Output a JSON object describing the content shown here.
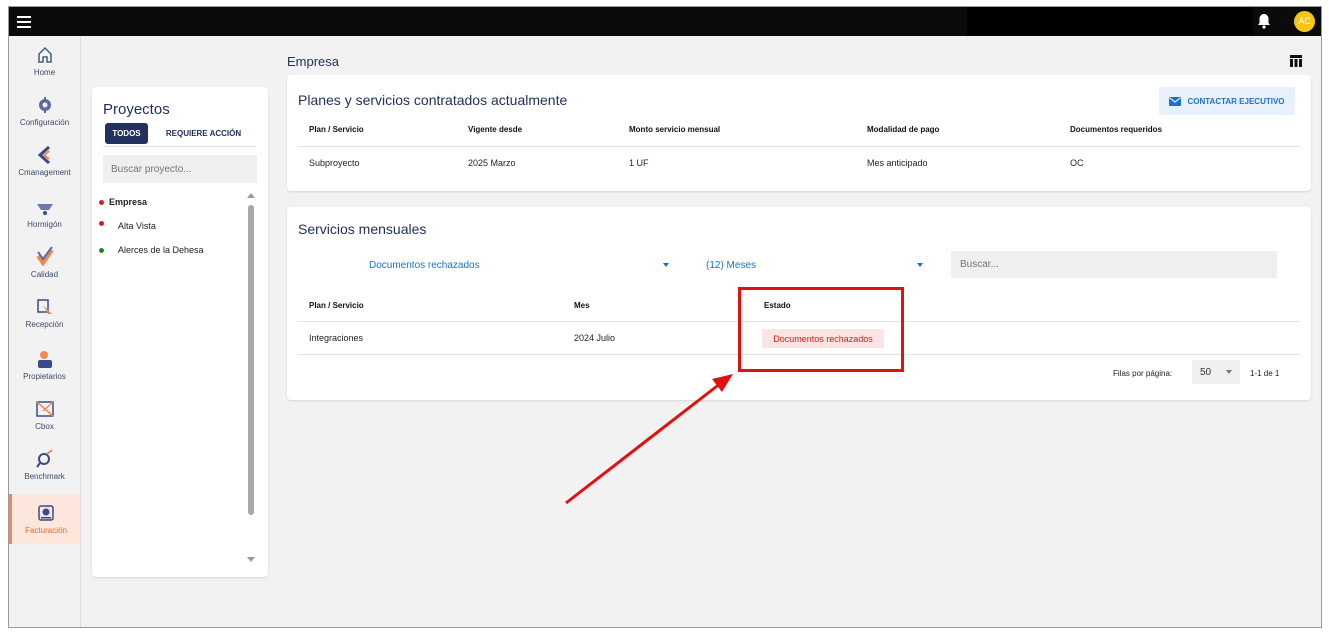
{
  "topbar": {
    "avatar_initials": "AC"
  },
  "nav": {
    "items": [
      {
        "label": "Home",
        "icon": "home-icon"
      },
      {
        "label": "Configuración",
        "icon": "gear-icon"
      },
      {
        "label": "Cmanagement",
        "icon": "cmanagement-icon"
      },
      {
        "label": "Hormigón",
        "icon": "wheelbarrow-icon"
      },
      {
        "label": "Calidad",
        "icon": "quality-check-icon"
      },
      {
        "label": "Recepción",
        "icon": "reception-icon"
      },
      {
        "label": "Propietarios",
        "icon": "owners-icon"
      },
      {
        "label": "Cbox",
        "icon": "cbox-icon"
      },
      {
        "label": "Benchmark",
        "icon": "benchmark-icon"
      },
      {
        "label": "Facturación",
        "icon": "billing-icon",
        "active": true
      }
    ]
  },
  "projects": {
    "title": "Proyectos",
    "tab_all": "TODOS",
    "tab_action": "REQUIERE ACCIÓN",
    "search_placeholder": "Buscar proyecto...",
    "items": [
      {
        "name": "Empresa",
        "status_color": "#e01b1b",
        "selected": true
      },
      {
        "name": "Alta Vista",
        "status_color": "#e01b1b"
      },
      {
        "name": "Alerces de la Dehesa",
        "status_color": "#1c8a1c"
      }
    ]
  },
  "page": {
    "title": "Empresa"
  },
  "plans": {
    "title": "Planes y servicios contratados actualmente",
    "contact_button": "CONTACTAR EJECUTIVO",
    "columns": [
      "Plan / Servicio",
      "Vigente desde",
      "Monto servicio mensual",
      "Modalidad de pago",
      "Documentos requeridos"
    ],
    "rows": [
      [
        "Subproyecto",
        "2025 Marzo",
        "1 UF",
        "Mes anticipado",
        "OC"
      ]
    ]
  },
  "monthly": {
    "title": "Servicios mensuales",
    "filter_status": "Documentos rechazados",
    "filter_period": "(12) Meses",
    "search_placeholder": "Buscar...",
    "columns": [
      "Plan / Servicio",
      "Mes",
      "Estado"
    ],
    "rows": [
      {
        "plan": "Integraciones",
        "month": "2024 Julio",
        "status": "Documentos rechazados"
      }
    ],
    "pager": {
      "rows_per_page_label": "Filas por página:",
      "rows_per_page": "50",
      "range": "1-1 de 1"
    }
  },
  "colors": {
    "accent": "#1a73c8",
    "navy": "#1f2f57",
    "annotation_red": "#e31010",
    "status_rejected": "#d21e1e"
  }
}
